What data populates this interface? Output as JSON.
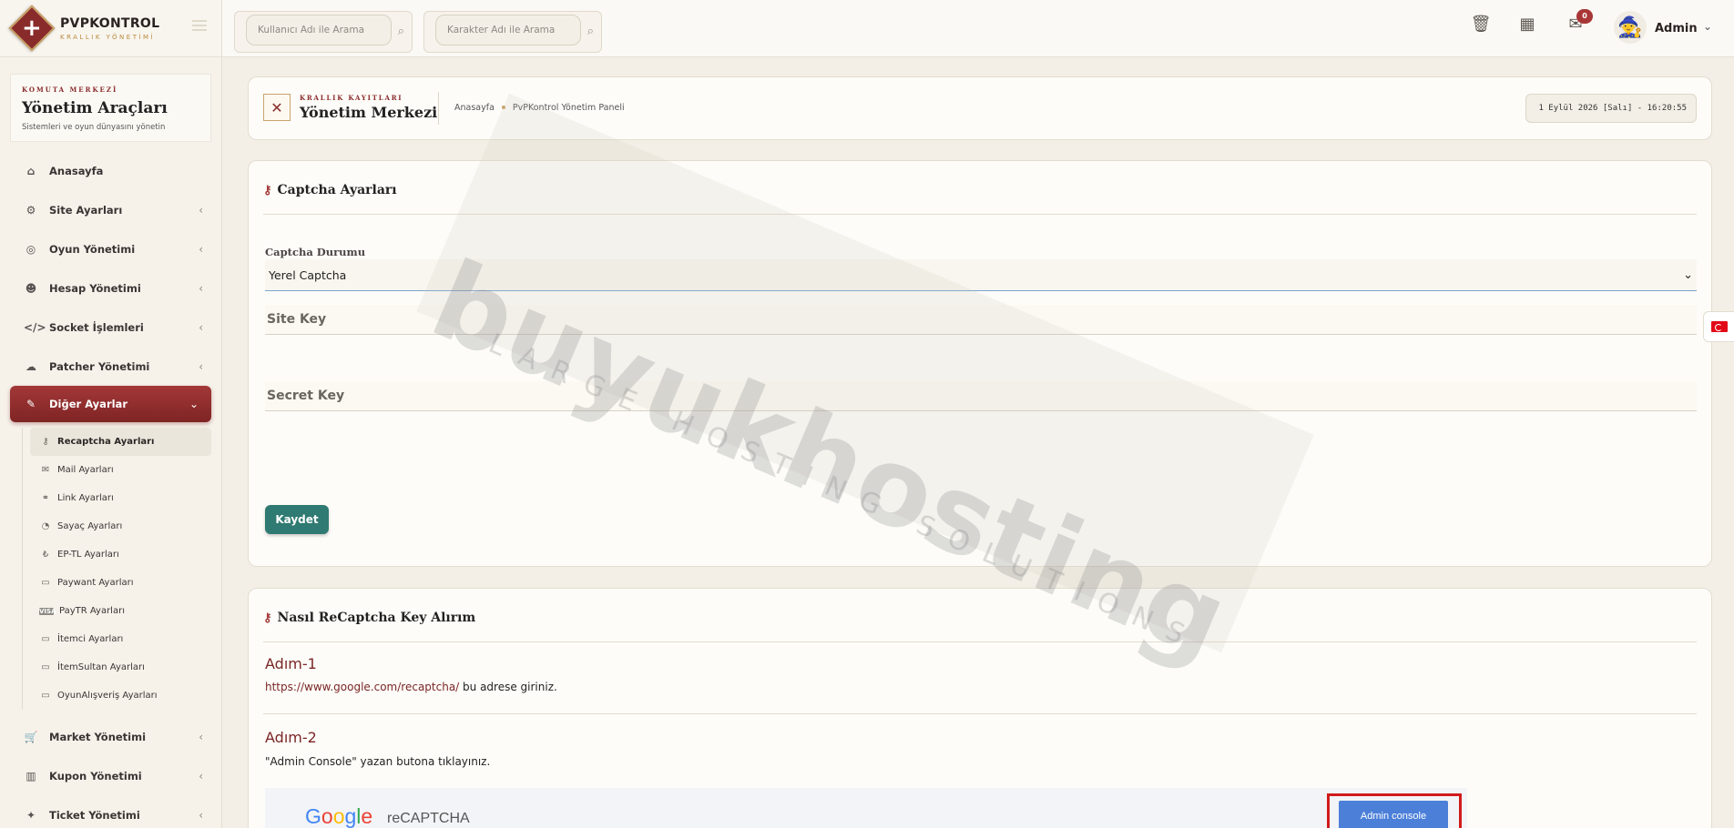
{
  "brand": {
    "name": "PVPKONTROL",
    "sub": "KRALLIK YÖNETİMİ"
  },
  "panel": {
    "kicker": "KOMUTA MERKEZİ",
    "title": "Yönetim Araçları",
    "desc": "Sistemleri ve oyun dünyasını yönetin"
  },
  "nav": [
    {
      "label": "Anasayfa",
      "icon": "home-icon"
    },
    {
      "label": "Site Ayarları",
      "icon": "gear-icon"
    },
    {
      "label": "Oyun Yönetimi",
      "icon": "gamepad-icon"
    },
    {
      "label": "Hesap Yönetimi",
      "icon": "users-icon"
    },
    {
      "label": "Socket İşlemleri",
      "icon": "code-icon"
    },
    {
      "label": "Patcher Yönetimi",
      "icon": "cloud-upload-icon"
    },
    {
      "label": "Diğer Ayarlar",
      "icon": "wrench-icon"
    }
  ],
  "subnav": [
    {
      "label": "Recaptcha Ayarları",
      "icon": "key-icon"
    },
    {
      "label": "Mail Ayarları",
      "icon": "mail-icon"
    },
    {
      "label": "Link Ayarları",
      "icon": "link-icon"
    },
    {
      "label": "Sayaç Ayarları",
      "icon": "speedometer-icon"
    },
    {
      "label": "EP-TL Ayarları",
      "icon": "coin-icon"
    },
    {
      "label": "Paywant Ayarları",
      "icon": "card-icon"
    },
    {
      "label": "PayTR Ayarları",
      "icon": "visa-icon"
    },
    {
      "label": "İtemci Ayarları",
      "icon": "card-icon"
    },
    {
      "label": "İtemSultan Ayarları",
      "icon": "card-icon"
    },
    {
      "label": "OyunAlışveriş Ayarları",
      "icon": "card-icon"
    }
  ],
  "nav_bottom": [
    {
      "label": "Market Yönetimi",
      "icon": "cart-icon"
    },
    {
      "label": "Kupon Yönetimi",
      "icon": "barcode-icon"
    },
    {
      "label": "Ticket Yönetimi",
      "icon": "ticket-icon"
    }
  ],
  "search": {
    "user_placeholder": "Kullanıcı Adı ile Arama",
    "char_placeholder": "Karakter Adı ile Arama"
  },
  "topbar": {
    "notification_count": "0",
    "admin_name": "Admin"
  },
  "header": {
    "kicker": "KRALLIK KAYITLARI",
    "title": "Yönetim Merkezi",
    "crumb_home": "Anasayfa",
    "crumb_current": "PvPKontrol Yönetim Paneli",
    "datetime": "1 Eylül 2026 [Salı] - 16:20:55"
  },
  "captcha_form": {
    "title": "Captcha Ayarları",
    "status_label": "Captcha Durumu",
    "status_value": "Yerel Captcha",
    "site_key_label": "Site Key",
    "secret_key_label": "Secret Key",
    "save_label": "Kaydet"
  },
  "howto": {
    "title": "Nasıl ReCaptcha Key Alırım",
    "step1_title": "Adım-1",
    "step1_link": "https://www.google.com/recaptcha/",
    "step1_text": " bu adrese giriniz.",
    "step2_title": "Adım-2",
    "step2_text": "\"Admin Console\" yazan butona tıklayınız.",
    "image_brand": "reCAPTCHA",
    "image_button": "Admin console"
  },
  "watermark": {
    "main": "buyukhosting",
    "sub": "LARGE HOSTING SOLUTIONS"
  },
  "colors": {
    "accent": "#8a2b2b",
    "active_nav": "#a33838",
    "save_button": "#2f7a72",
    "gold": "#c9a36a"
  }
}
